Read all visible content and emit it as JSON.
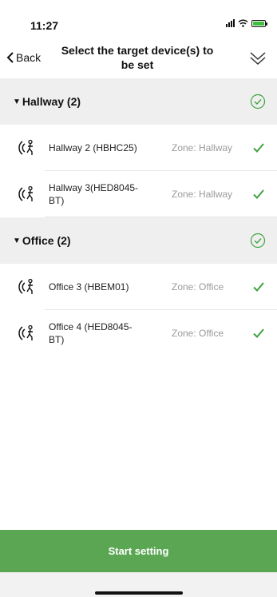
{
  "status_bar": {
    "time": "11:27"
  },
  "nav": {
    "back_label": "Back",
    "title": "Select the target device(s) to be set"
  },
  "groups": [
    {
      "title": "Hallway (2)",
      "devices": [
        {
          "name": "Hallway 2 (HBHC25)",
          "zone": "Zone: Hallway"
        },
        {
          "name": "Hallway 3(HED8045-BT)",
          "zone": "Zone: Hallway"
        }
      ]
    },
    {
      "title": "Office (2)",
      "devices": [
        {
          "name": "Office 3 (HBEM01)",
          "zone": "Zone: Office"
        },
        {
          "name": "Office 4 (HED8045-BT)",
          "zone": "Zone: Office"
        }
      ]
    }
  ],
  "footer": {
    "start_button": "Start setting"
  },
  "colors": {
    "accent_green": "#5aa653",
    "check_green": "#3fa33f"
  }
}
